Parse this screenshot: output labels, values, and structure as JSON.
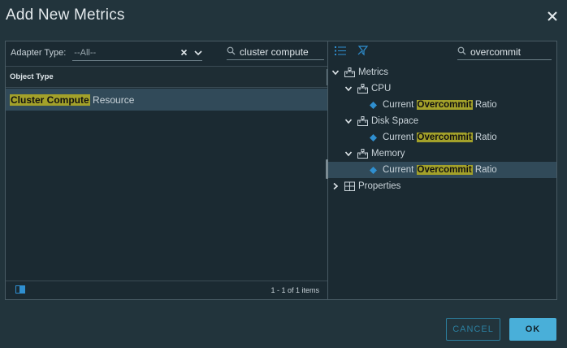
{
  "dialog": {
    "title": "Add New Metrics"
  },
  "left": {
    "adapter_label": "Adapter Type:",
    "adapter_value": "--All--",
    "search_value": "cluster compute",
    "column_header": "Object Type",
    "row": {
      "highlight": "Cluster Compute",
      "rest": " Resource"
    },
    "footer_text": "1 - 1 of 1 items"
  },
  "right": {
    "search_value": "overcommit",
    "tree": {
      "root": "Metrics",
      "groups": [
        {
          "name": "CPU",
          "leaf_prefix": "Current ",
          "leaf_highlight": "Overcommit",
          "leaf_suffix": " Ratio"
        },
        {
          "name": "Disk Space",
          "leaf_prefix": "Current ",
          "leaf_highlight": "Overcommit",
          "leaf_suffix": " Ratio"
        },
        {
          "name": "Memory",
          "leaf_prefix": "Current ",
          "leaf_highlight": "Overcommit",
          "leaf_suffix": " Ratio"
        }
      ],
      "properties": "Properties"
    }
  },
  "buttons": {
    "cancel": "CANCEL",
    "ok": "OK"
  },
  "colors": {
    "accent": "#49afd9",
    "highlight": "#a3a12a",
    "selected_row": "#314a59",
    "diamond": "#2f8fd0"
  }
}
